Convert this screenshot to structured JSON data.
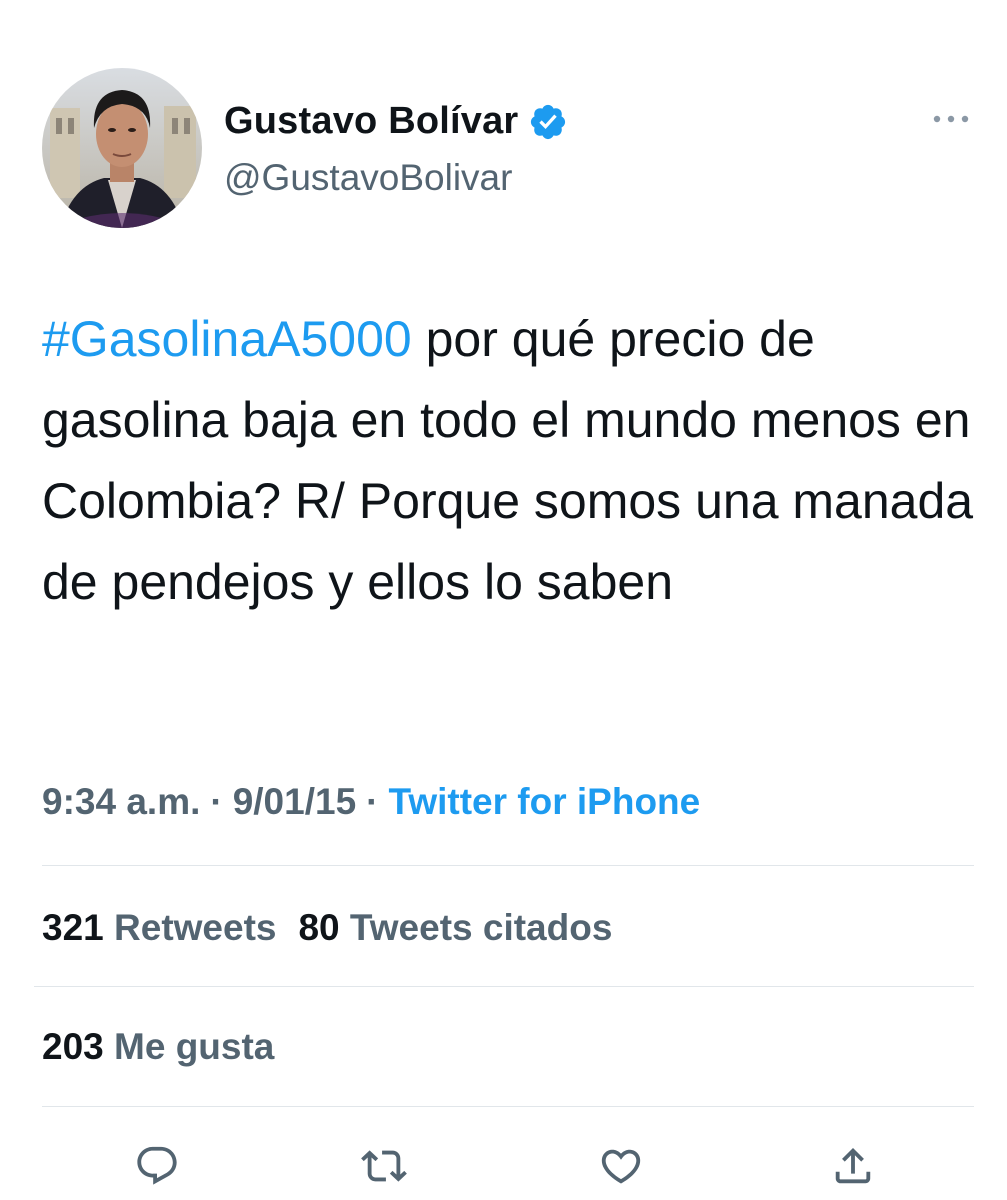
{
  "author": {
    "display_name": "Gustavo Bolívar",
    "handle": "@GustavoBolivar",
    "verified": true,
    "avatar_icon": "profile-photo"
  },
  "tweet": {
    "hashtag": "#GasolinaA5000",
    "text": " por qué precio de gasolina baja en todo el mundo menos en Colombia? R/ Porque somos una manada de pendejos y ellos lo saben"
  },
  "meta": {
    "time": "9:34 a.m.",
    "separator": "·",
    "date": "9/01/15",
    "source": "Twitter for iPhone"
  },
  "stats": {
    "retweets_count": "321",
    "retweets_label": "Retweets",
    "quotes_count": "80",
    "quotes_label": "Tweets citados",
    "likes_count": "203",
    "likes_label": "Me gusta"
  },
  "actions": {
    "reply_icon": "reply-icon",
    "retweet_icon": "retweet-icon",
    "like_icon": "heart-icon",
    "share_icon": "share-icon",
    "more_icon": "more-icon"
  },
  "colors": {
    "accent": "#1d9bf0",
    "text_primary": "#0f1419",
    "text_secondary": "#536471",
    "divider": "#e1e6ea",
    "icon": "#536471"
  }
}
